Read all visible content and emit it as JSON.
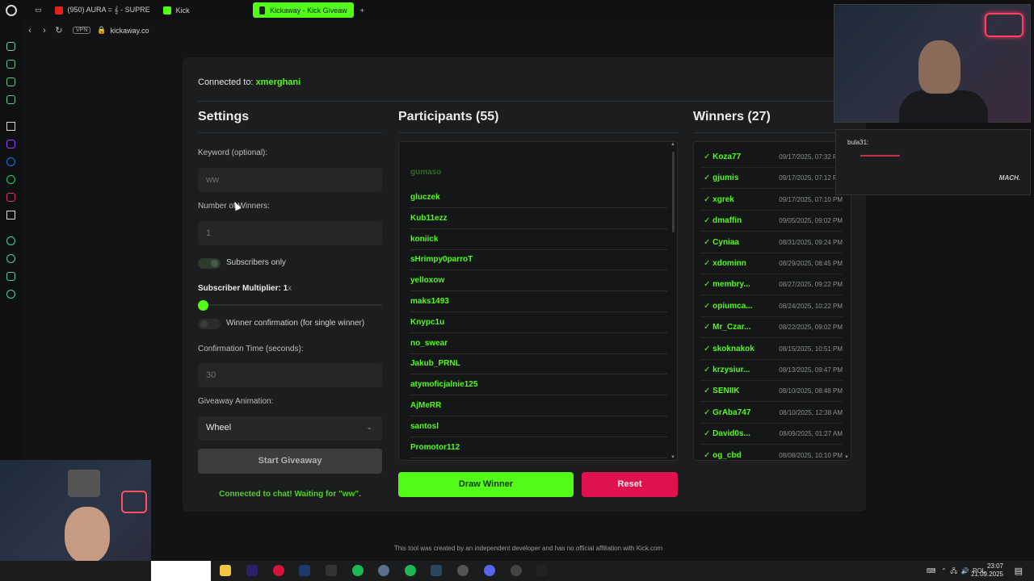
{
  "browser": {
    "tabs": [
      {
        "label": "(950) AURA = 𝄞 - SUPRE",
        "active": false,
        "icon": "youtube-icon"
      },
      {
        "label": "Kick",
        "active": false,
        "icon": "kick-icon"
      },
      {
        "label": "Kickaway - Kick Giveaw",
        "active": true,
        "icon": "kickaway-icon"
      }
    ],
    "vpn_label": "VPN",
    "url": "kickaway.co"
  },
  "app": {
    "connected_prefix": "Connected to:",
    "connected_user": "xmerghani",
    "settings": {
      "title": "Settings",
      "keyword_label": "Keyword (optional):",
      "keyword_value": "ww",
      "winners_label": "Number of Winners:",
      "winners_value": "1",
      "subscribers_only_label": "Subscribers only",
      "multiplier_label": "Subscriber Multiplier: 1",
      "multiplier_unit": "x",
      "multiplier_value": 1,
      "winner_confirm_label": "Winner confirmation (for single winner)",
      "confirm_time_label": "Confirmation Time (seconds):",
      "confirm_time_value": "30",
      "animation_label": "Giveaway Animation:",
      "animation_value": "Wheel",
      "start_button": "Start Giveaway",
      "status_text": "Connected to chat! Waiting for \"ww\"."
    },
    "participants": {
      "title": "Participants (55)",
      "items": [
        "gumaso",
        "gluczek",
        "Kub11ezz",
        "koniick",
        "sHrimpy0parroT",
        "yelloxow",
        "maks1493",
        "Knypc1u",
        "no_swear",
        "Jakub_PRNL",
        "atymoficjalnie125",
        "AjMeRR",
        "santosl",
        "Promotor112"
      ],
      "draw_button": "Draw Winner",
      "reset_button": "Reset"
    },
    "winners": {
      "title": "Winners (27)",
      "items": [
        {
          "name": "✓ Koza77",
          "date": "09/17/2025, 07:32 PM"
        },
        {
          "name": "✓ gjumis",
          "date": "09/17/2025, 07:12 PM"
        },
        {
          "name": "✓ xgrek",
          "date": "09/17/2025, 07:10 PM"
        },
        {
          "name": "✓ dmaffin",
          "date": "09/05/2025, 09:02 PM"
        },
        {
          "name": "✓ Cyniaa",
          "date": "08/31/2025, 09:24 PM"
        },
        {
          "name": "✓ xdominn",
          "date": "08/29/2025, 08:45 PM"
        },
        {
          "name": "✓ membry...",
          "date": "08/27/2025, 09:22 PM"
        },
        {
          "name": "✓ opiumca...",
          "date": "08/24/2025, 10:22 PM"
        },
        {
          "name": "✓ Mr_Czar...",
          "date": "08/22/2025, 09:02 PM"
        },
        {
          "name": "✓ skoknakok",
          "date": "08/15/2025, 10:51 PM"
        },
        {
          "name": "✓ krzysiur...",
          "date": "08/13/2025, 09:47 PM"
        },
        {
          "name": "✓ SENIIK",
          "date": "08/10/2025, 08:48 PM"
        },
        {
          "name": "✓ GrAba747",
          "date": "08/10/2025, 12:38 AM"
        },
        {
          "name": "✓ David0s...",
          "date": "08/09/2025, 01:27 AM"
        },
        {
          "name": "✓ og_cbd",
          "date": "08/08/2025, 10:10 PM"
        }
      ]
    },
    "footer": "This tool was created by an independent developer and has no official affiliation with Kick.com"
  },
  "overlay": {
    "chat_user": "bula31:",
    "watermark": "MACH."
  },
  "taskbar": {
    "language": "POL",
    "time": "23:07",
    "date": "21.09.2025"
  },
  "colors": {
    "accent": "#53fc18",
    "danger": "#e0114f",
    "card": "#1b1d1e",
    "background": "#111314"
  }
}
